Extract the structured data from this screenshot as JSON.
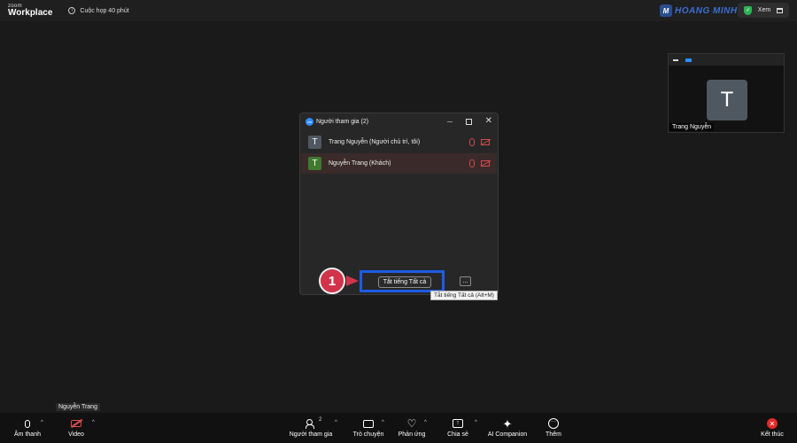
{
  "top_bar": {
    "brand_small": "zoom",
    "brand_large": "Workplace",
    "meeting_info": "Cuộc họp 40 phút",
    "watermark": "HOANG MINH",
    "view_label": "Xem"
  },
  "thumbnail": {
    "avatar_letter": "T",
    "name": "Trang Nguyễn"
  },
  "participants_panel": {
    "title": "Người tham gia (2)",
    "participants": [
      {
        "initial": "T",
        "name": "Trang Nguyễn (Người chủ trì, tôi)",
        "avatar_color": "#4f5861"
      },
      {
        "initial": "T",
        "name": "Nguyễn Trang (Khách)",
        "avatar_color": "#3f7a2d"
      }
    ],
    "mute_all_label": "Tắt tiếng Tất cả",
    "more_label": "...",
    "tooltip": "Tắt tiếng Tất cả (Alt+M)"
  },
  "annotation": {
    "step_number": "1",
    "accent_color": "#d1344a",
    "highlight_color": "#1e5ce6"
  },
  "self_view_name": "Nguyễn Trang",
  "toolbar": {
    "audio": "Âm thanh",
    "video": "Video",
    "participants": "Người tham gia",
    "participants_count": "2",
    "chat": "Trò chuyện",
    "reactions": "Phản ứng",
    "share": "Chia sẻ",
    "ai_companion": "AI Companion",
    "more": "Thêm",
    "end": "Kết thúc"
  }
}
